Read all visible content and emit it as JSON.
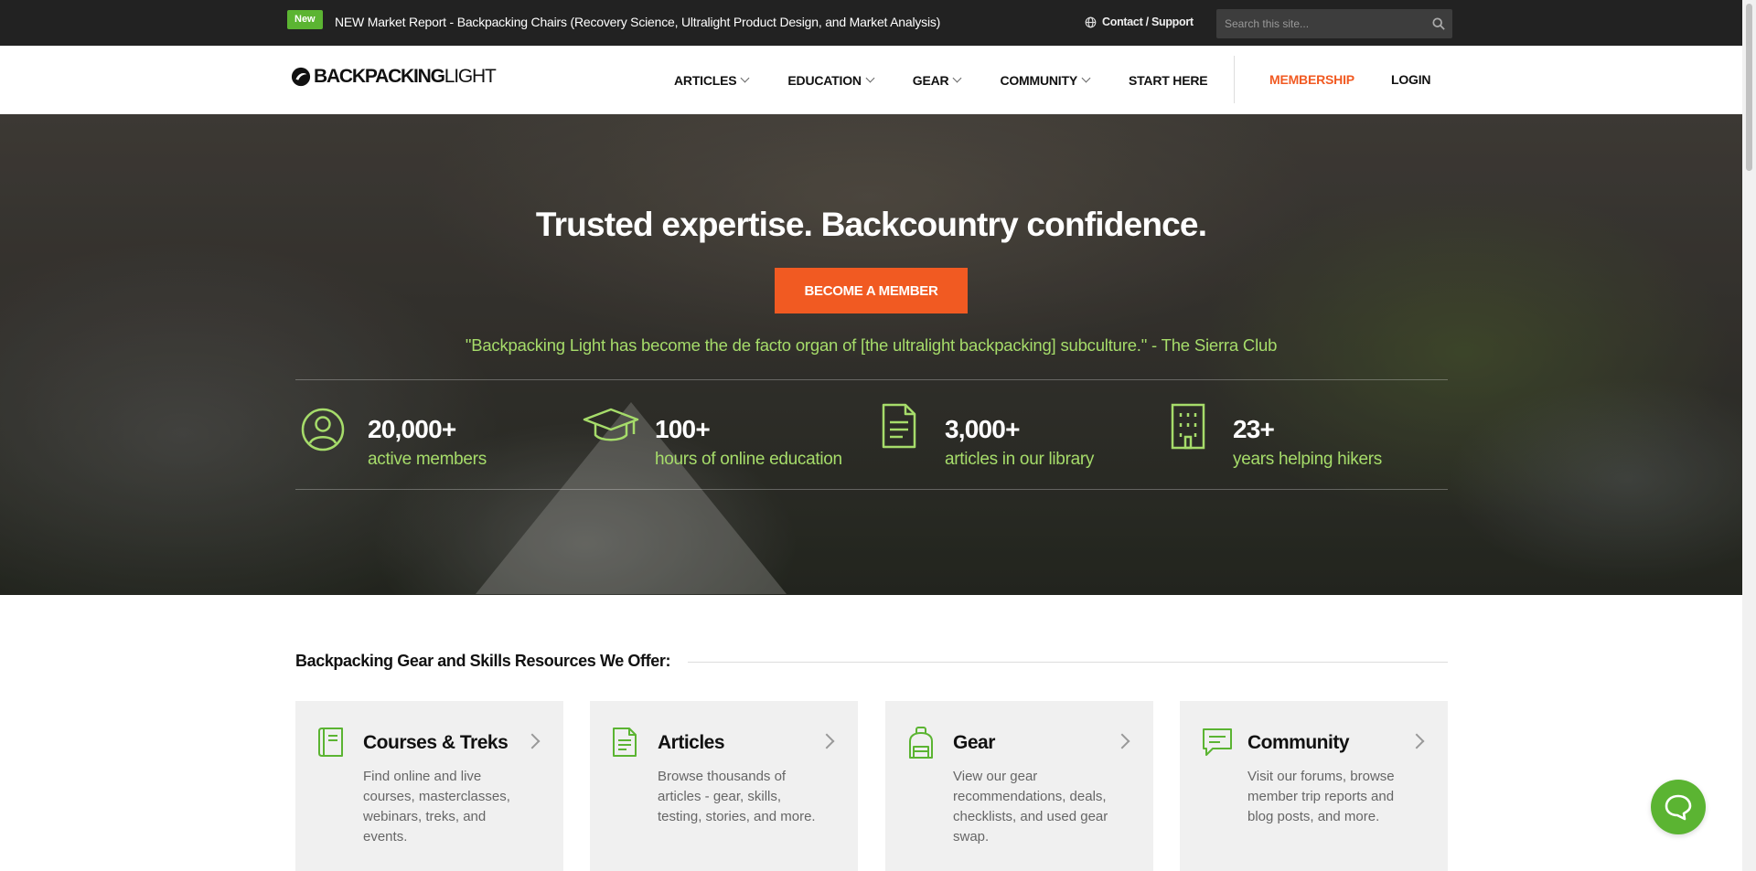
{
  "topbar": {
    "badge": "New",
    "announcement": "NEW Market Report - Backpacking Chairs (Recovery Science, Ultralight Product Design, and Market Analysis)",
    "contact_label": "Contact / Support",
    "search_placeholder": "Search this site..."
  },
  "nav": {
    "logo_bold": "BACKPACKING",
    "logo_light": "LIGHT",
    "logo_mark": "·",
    "items": [
      {
        "label": "ARTICLES"
      },
      {
        "label": "EDUCATION"
      },
      {
        "label": "GEAR"
      },
      {
        "label": "COMMUNITY"
      },
      {
        "label": "START HERE"
      }
    ],
    "membership": "MEMBERSHIP",
    "login": "LOGIN"
  },
  "hero": {
    "title": "Trusted expertise. Backcountry confidence.",
    "cta": "BECOME A MEMBER",
    "quote": "\"Backpacking Light has become the de facto organ of [the ultralight backpacking] subculture.\" - The Sierra Club",
    "stats": [
      {
        "num": "20,000+",
        "label": "active members",
        "icon": "user-circle-icon"
      },
      {
        "num": "100+",
        "label": "hours of online education",
        "icon": "graduation-cap-icon"
      },
      {
        "num": "3,000+",
        "label": "articles in our library",
        "icon": "document-icon"
      },
      {
        "num": "23+",
        "label": "years helping hikers",
        "icon": "building-icon"
      }
    ]
  },
  "resources": {
    "heading": "Backpacking Gear and Skills Resources We Offer:",
    "cards": [
      {
        "title": "Courses & Treks",
        "desc": "Find online and live courses, masterclasses, webinars, treks, and events.",
        "icon": "book-icon"
      },
      {
        "title": "Articles",
        "desc": "Browse thousands of articles - gear, skills, testing, stories, and more.",
        "icon": "document-icon"
      },
      {
        "title": "Gear",
        "desc": "View our gear recommendations, deals, checklists, and used gear swap.",
        "icon": "backpack-icon"
      },
      {
        "title": "Community",
        "desc": "Visit our forums, browse member trip reports and blog posts, and more.",
        "icon": "chat-bubble-icon"
      }
    ]
  },
  "colors": {
    "accent_orange": "#f15a22",
    "accent_green": "#5bb432",
    "quote_green": "#a6dc6a",
    "topbar_bg": "#222222"
  }
}
